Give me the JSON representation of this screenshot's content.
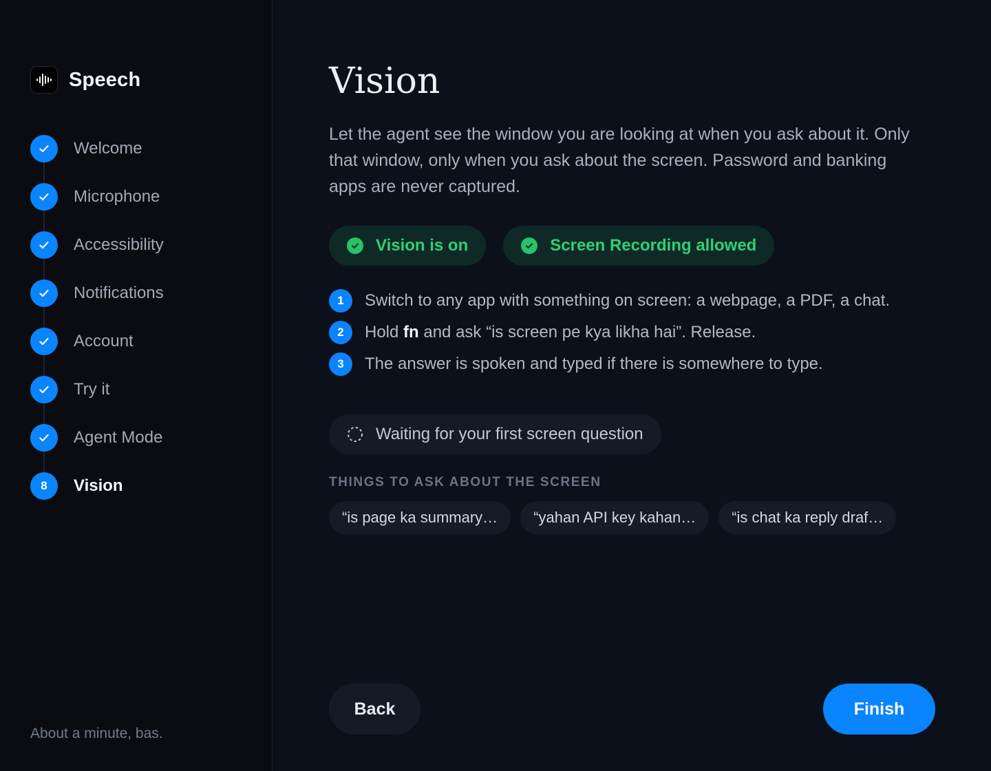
{
  "sidebar": {
    "brand": {
      "name": "Speech",
      "icon": "waveform-icon"
    },
    "steps": [
      {
        "label": "Welcome",
        "state": "done"
      },
      {
        "label": "Microphone",
        "state": "done"
      },
      {
        "label": "Accessibility",
        "state": "done"
      },
      {
        "label": "Notifications",
        "state": "done"
      },
      {
        "label": "Account",
        "state": "done"
      },
      {
        "label": "Try it",
        "state": "done"
      },
      {
        "label": "Agent Mode",
        "state": "done"
      },
      {
        "label": "Vision",
        "state": "current",
        "number": "8"
      }
    ],
    "footnote": "About a minute, bas."
  },
  "main": {
    "title": "Vision",
    "description": "Let the agent see the window you are looking at when you ask about it. Only that window, only when you ask about the screen. Password and banking apps are never captured.",
    "status": [
      {
        "label": "Vision is on",
        "state": "ok"
      },
      {
        "label": "Screen Recording allowed",
        "state": "ok"
      }
    ],
    "instructions": [
      {
        "num": "1",
        "text": "Switch to any app with something on screen: a webpage, a PDF, a chat."
      },
      {
        "num": "2",
        "before": "Hold ",
        "key": "fn",
        "after": " and ask “is screen pe kya likha hai”. Release."
      },
      {
        "num": "3",
        "text": "The answer is spoken and typed if there is somewhere to type."
      }
    ],
    "waiting": "Waiting for your first screen question",
    "suggestions_label": "THINGS TO ASK ABOUT THE SCREEN",
    "suggestions": [
      "“is page ka summary…",
      "“yahan API key kahan…",
      "“is chat ka reply draf…"
    ],
    "back_label": "Back",
    "finish_label": "Finish"
  },
  "colors": {
    "accent": "#0a84ff",
    "success": "#2fcf78",
    "background": "#0c101b",
    "sidebar": "#0a0c12"
  }
}
